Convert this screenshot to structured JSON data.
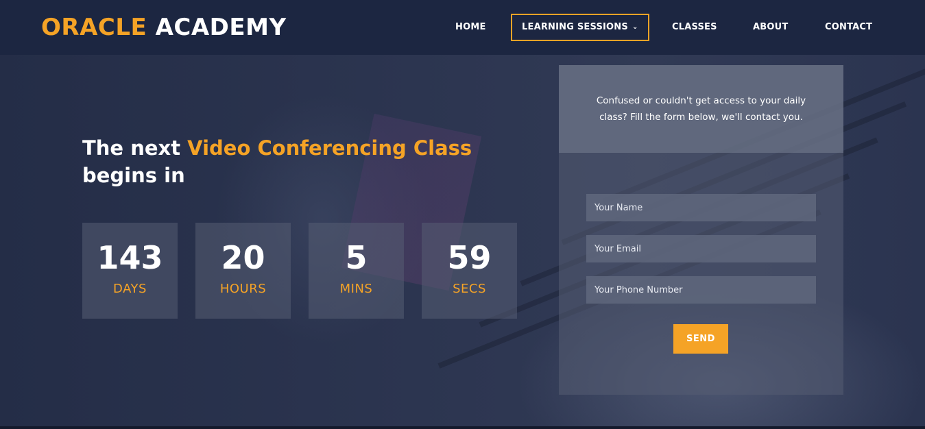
{
  "brand": {
    "word1": "ORACLE",
    "word2": "ACADEMY",
    "accent_color": "#f5a326"
  },
  "nav": {
    "home": "HOME",
    "learning_sessions": "LEARNING SESSIONS",
    "classes": "CLASSES",
    "about": "ABOUT",
    "contact": "CONTACT",
    "active_item": "LEARNING SESSIONS"
  },
  "hero": {
    "title_pre": "The next ",
    "title_highlight": "Video Conferencing Class",
    "title_post": "begins in"
  },
  "countdown": {
    "days": {
      "value": "143",
      "label": "DAYS"
    },
    "hours": {
      "value": "20",
      "label": "HOURS"
    },
    "mins": {
      "value": "5",
      "label": "MINS"
    },
    "secs": {
      "value": "59",
      "label": "SECS"
    }
  },
  "form": {
    "message": "Confused or couldn't get access to your daily class? Fill the form below, we'll contact you.",
    "name_placeholder": "Your Name",
    "email_placeholder": "Your Email",
    "phone_placeholder": "Your Phone Number",
    "send_label": "SEND"
  },
  "colors": {
    "header_bg": "#1c2641",
    "accent": "#f5a326",
    "text": "#ffffff"
  }
}
